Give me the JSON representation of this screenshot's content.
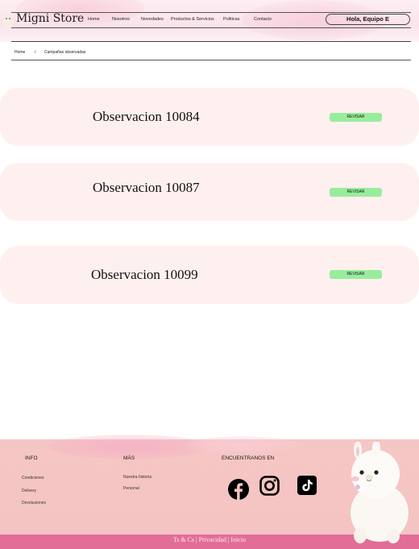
{
  "header": {
    "brand": "Migni Store",
    "nav": [
      "Home",
      "Nosotros",
      "Novedades",
      "Productos & Servicios",
      "Politicas",
      "Contacto"
    ],
    "user": "Hola, Equipo E"
  },
  "breadcrumb": {
    "home": "Home",
    "separator": "/",
    "current": "Campañas observadas"
  },
  "observations": [
    {
      "title": "Observacion 10084",
      "button": "REVISAR"
    },
    {
      "title": "Observacion 10087",
      "button": "REVISAR"
    },
    {
      "title": "Observacion 10099",
      "button": "REVISAR"
    }
  ],
  "footer": {
    "info": {
      "heading": "INFO",
      "links": [
        "Condiciones",
        "Delivery",
        "Devoluciones"
      ]
    },
    "mas": {
      "heading": "MÁS",
      "links": [
        "Nuestra historia",
        "Personal"
      ]
    },
    "social": {
      "heading": "ENCUENTRANOS EN",
      "icons": [
        "facebook-icon",
        "instagram-icon",
        "tiktok-icon"
      ]
    },
    "bottom": "Ts & Cs |  Privacidad  | Inicio"
  },
  "colors": {
    "card_bg": "#fff0f0",
    "button_bg": "#98ed9c",
    "footer_bg": "#f5c6c4",
    "footer_bar": "#e26d97"
  }
}
